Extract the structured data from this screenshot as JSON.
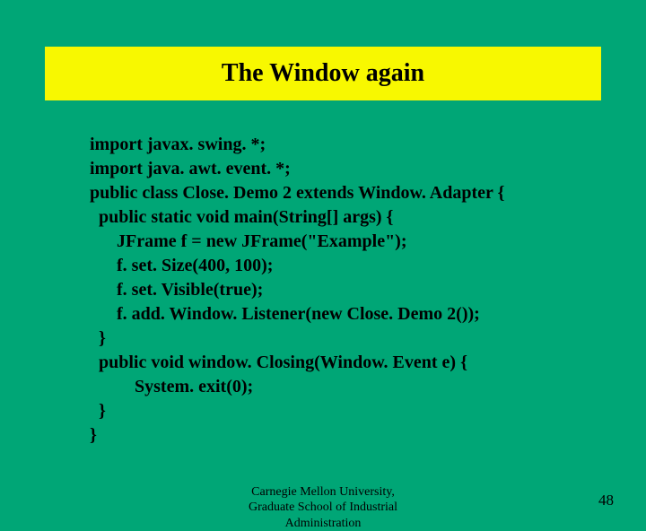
{
  "title": "The Window again",
  "code": {
    "l1": "import javax. swing. *;",
    "l2": "import java. awt. event. *;",
    "l3": "public class Close. Demo 2 extends Window. Adapter {",
    "l4": "  public static void main(String[] args) {",
    "l5": "      JFrame f = new JFrame(\"Example\");",
    "l6": "      f. set. Size(400, 100);",
    "l7": "      f. set. Visible(true);",
    "l8": "      f. add. Window. Listener(new Close. Demo 2());",
    "l9": "  }",
    "l10": "  public void window. Closing(Window. Event e) {",
    "l11": "          System. exit(0);",
    "l12": "  }",
    "l13": "}"
  },
  "footer": {
    "line1": "Carnegie Mellon University,",
    "line2": "Graduate School of Industrial",
    "line3": "Administration"
  },
  "page_number": "48"
}
